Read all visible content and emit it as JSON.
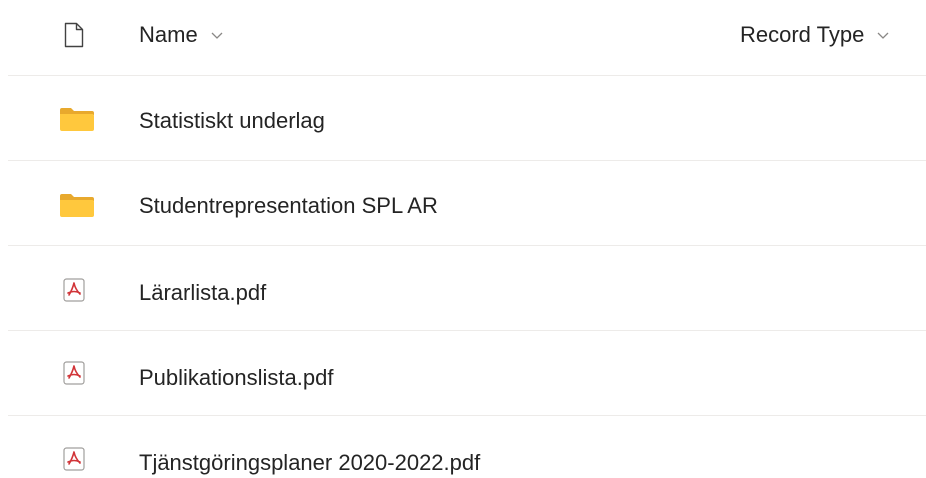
{
  "header": {
    "file_type_icon": "document-icon",
    "name_label": "Name",
    "record_type_label": "Record Type"
  },
  "rows": [
    {
      "label": "Statistiskt underlag",
      "icon": "folder-icon"
    },
    {
      "label": "Studentrepresentation SPL AR",
      "icon": "folder-icon"
    },
    {
      "label": "Lärarlista.pdf",
      "icon": "pdf-icon"
    },
    {
      "label": "Publikationslista.pdf",
      "icon": "pdf-icon"
    },
    {
      "label": "Tjänstgöringsplaner 2020-2022.pdf",
      "icon": "pdf-icon"
    }
  ],
  "colors": {
    "folder": "#ffc83d",
    "pdf_accent": "#d13438",
    "divider": "#edebe9",
    "text": "#242424"
  }
}
